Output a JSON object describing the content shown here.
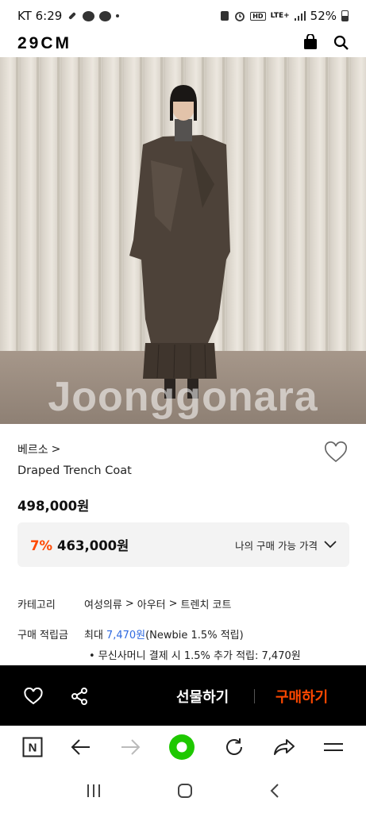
{
  "status_bar": {
    "carrier_time": "KT 6:29",
    "battery": "52%",
    "hd_label": "HD",
    "lte_label": "LTE+"
  },
  "header": {
    "logo": "29CM",
    "icons": [
      "shopping-bag-icon",
      "search-icon"
    ]
  },
  "product": {
    "watermark": "Joonggonara",
    "brand": "베르소",
    "brand_chevron": ">",
    "name": "Draped Trench Coat",
    "price": "498,000원",
    "discount_percent": "7%",
    "discount_price": "463,000원",
    "my_price_label": "나의 구매 가능 가격"
  },
  "info": {
    "category_label": "카테고리",
    "category_path": [
      "여성의류",
      "아우터",
      "트렌치 코트"
    ],
    "points_label": "구매 적립금",
    "points_prefix": "최대",
    "points_value": "7,470원",
    "points_suffix": "(Newbie 1.5% 적립)",
    "points_bullet": "• 무신사머니 결제 시 1.5% 추가 적립: 7,470원"
  },
  "action_bar": {
    "gift_label": "선물하기",
    "buy_label": "구매하기",
    "buy_color": "#ff4800"
  },
  "browser_bar": {
    "icons": [
      "naver-n-icon",
      "back-arrow-icon",
      "forward-arrow-icon",
      "green-home-icon",
      "refresh-icon",
      "share-icon",
      "menu-icon"
    ],
    "n_label": "N",
    "accent": "#1ec800"
  },
  "system_nav": {
    "icons": [
      "recent-apps-icon",
      "home-icon",
      "back-icon"
    ]
  }
}
